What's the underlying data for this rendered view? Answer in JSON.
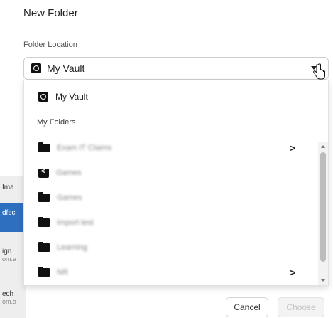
{
  "dialog": {
    "title": "New Folder"
  },
  "location": {
    "label": "Folder Location",
    "selected": "My Vault"
  },
  "dropdown": {
    "vault_item": "My Vault",
    "heading": "My Folders",
    "folders": [
      {
        "name": "Exam IT Claims",
        "icon": "folder-icon",
        "has_children": true
      },
      {
        "name": "Games",
        "icon": "shared-folder-icon",
        "has_children": false
      },
      {
        "name": "Games",
        "icon": "folder-icon",
        "has_children": false
      },
      {
        "name": "Import test",
        "icon": "folder-icon",
        "has_children": false
      },
      {
        "name": "Learning",
        "icon": "folder-icon",
        "has_children": false
      },
      {
        "name": "NR",
        "icon": "folder-icon",
        "has_children": true
      }
    ],
    "chevron": ">"
  },
  "background_page": {
    "rows": [
      {
        "text": "Ima",
        "sub": ""
      },
      {
        "text": "dfsc",
        "sub": ""
      },
      {
        "text": "ign",
        "sub": "om.a"
      },
      {
        "text": "ech",
        "sub": "om.a"
      }
    ]
  },
  "buttons": {
    "cancel": "Cancel",
    "choose": "Choose"
  },
  "colors": {
    "selected_row": "#2f6fbf",
    "icon": "#111111",
    "disabled_text": "#c4c4c4"
  }
}
